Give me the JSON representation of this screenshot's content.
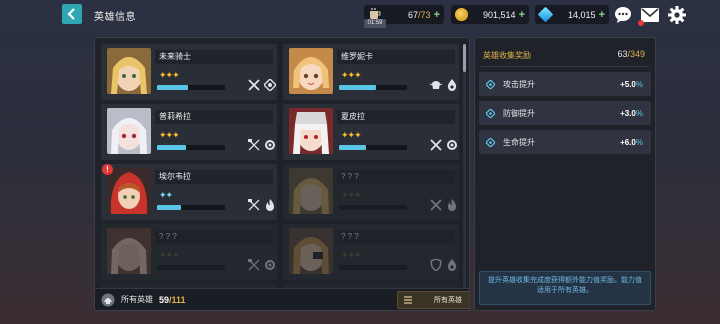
{
  "header": {
    "title": "英雄信息",
    "stamina": {
      "value": "67",
      "max": "/73",
      "timer": "01:59"
    },
    "gold": {
      "value": "901,514"
    },
    "gems": {
      "value": "14,015"
    },
    "plus": "+"
  },
  "heroes": [
    {
      "name": "未来骑士",
      "stars": "✦✦✦",
      "star_color": "gold",
      "progress": 0.45
    },
    {
      "name": "维罗妮卡",
      "stars": "✦✦✦",
      "star_color": "gold",
      "progress": 0.55
    },
    {
      "name": "普莉希拉",
      "stars": "✦✦✦",
      "star_color": "gold",
      "progress": 0.42
    },
    {
      "name": "夏皮拉",
      "stars": "✦✦✦",
      "star_color": "gold",
      "progress": 0.4
    },
    {
      "name": "埃尔韦拉",
      "stars": "✦✦",
      "star_color": "blue",
      "progress": 0.35,
      "alert": "!"
    },
    {
      "name": "? ? ?",
      "stars": "✦✦✦",
      "star_color": "dim",
      "progress": 0
    },
    {
      "name": "? ? ?",
      "stars": "✦✦✦",
      "star_color": "dim",
      "progress": 0
    },
    {
      "name": "? ? ?",
      "stars": "✦✦✦",
      "star_color": "dim",
      "progress": 0
    }
  ],
  "footer": {
    "label": "所有英雄",
    "count": "59",
    "total": "/111",
    "filter_label": "所有英雄"
  },
  "rewards": {
    "title": "英雄收集奖励",
    "count": "63",
    "total": "/349",
    "rows": [
      {
        "label": "攻击提升",
        "value": "+5.0",
        "pct": "%"
      },
      {
        "label": "防御提升",
        "value": "+3.0",
        "pct": "%"
      },
      {
        "label": "生命提升",
        "value": "+6.0",
        "pct": "%"
      }
    ],
    "note": "提升英雄收集完成度获得额外能力值奖励。能力值适用于所有英雄。"
  },
  "colors": {
    "accent_teal": "#2fa6b4",
    "gold": "#ffbf26",
    "progress": "#59c6e8",
    "alert": "#e23838"
  }
}
